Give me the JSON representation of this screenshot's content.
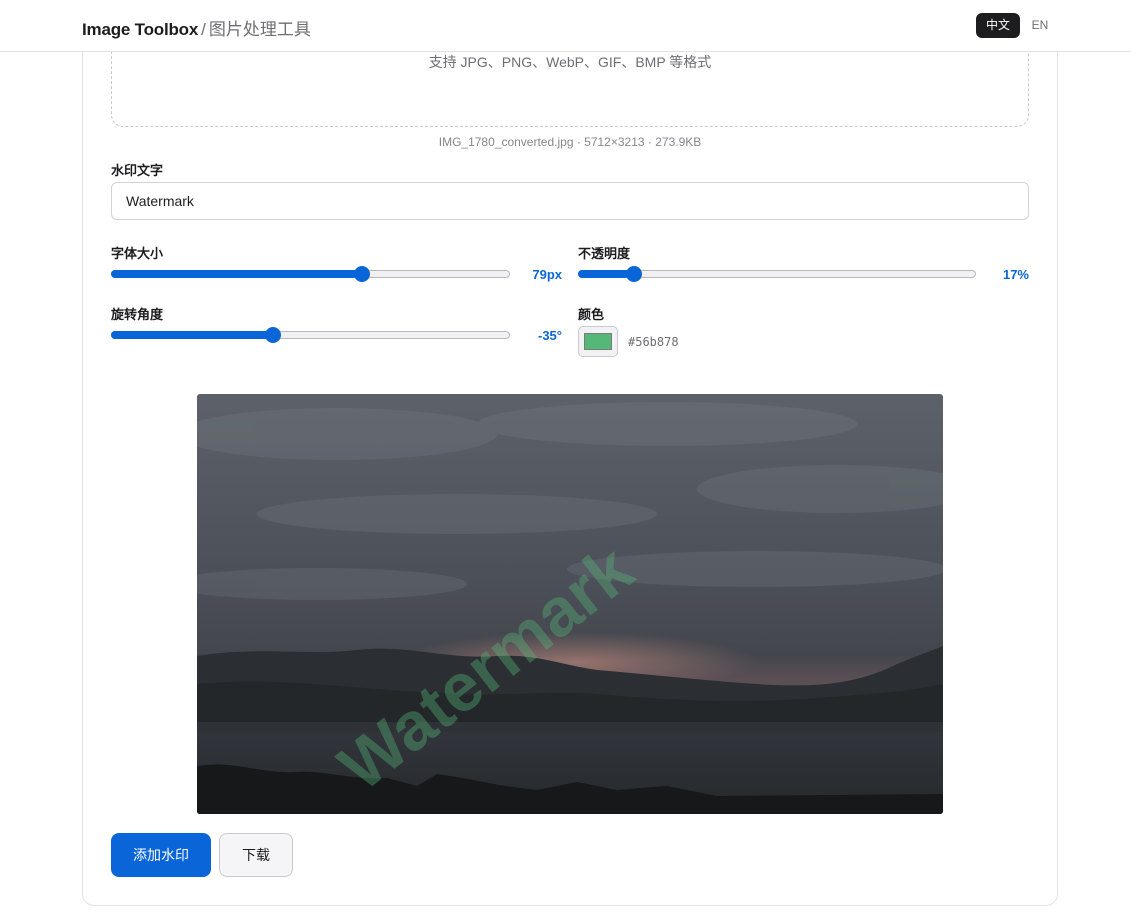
{
  "header": {
    "brand_name": "Image Toolbox",
    "brand_separator": "/",
    "brand_subtitle": "图片处理工具",
    "lang_zh": "中文",
    "lang_en": "EN",
    "active_lang": "中文"
  },
  "upload": {
    "formats_hint": "支持 JPG、PNG、WebP、GIF、BMP 等格式",
    "file_info": "IMG_1780_converted.jpg · 5712×3213 · 273.9KB"
  },
  "watermark_text": {
    "label": "水印文字",
    "value": "Watermark"
  },
  "font_size": {
    "label": "字体大小",
    "display": "79px",
    "value": 79,
    "fraction": 0.63
  },
  "opacity": {
    "label": "不透明度",
    "display": "17%",
    "value": 17,
    "fraction": 0.14
  },
  "rotation": {
    "label": "旋转角度",
    "display": "-35°",
    "value": -35,
    "fraction": 0.405
  },
  "color": {
    "label": "颜色",
    "hex": "#56b878"
  },
  "preview": {
    "watermark_text": "Watermark",
    "watermark_color": "#56b878",
    "watermark_opacity": 0.17,
    "watermark_rotation": -35
  },
  "actions": {
    "apply_label": "添加水印",
    "download_label": "下载"
  },
  "colors": {
    "accent": "#0a66d8",
    "text": "#1d1d1f",
    "muted": "#6e6e73"
  }
}
